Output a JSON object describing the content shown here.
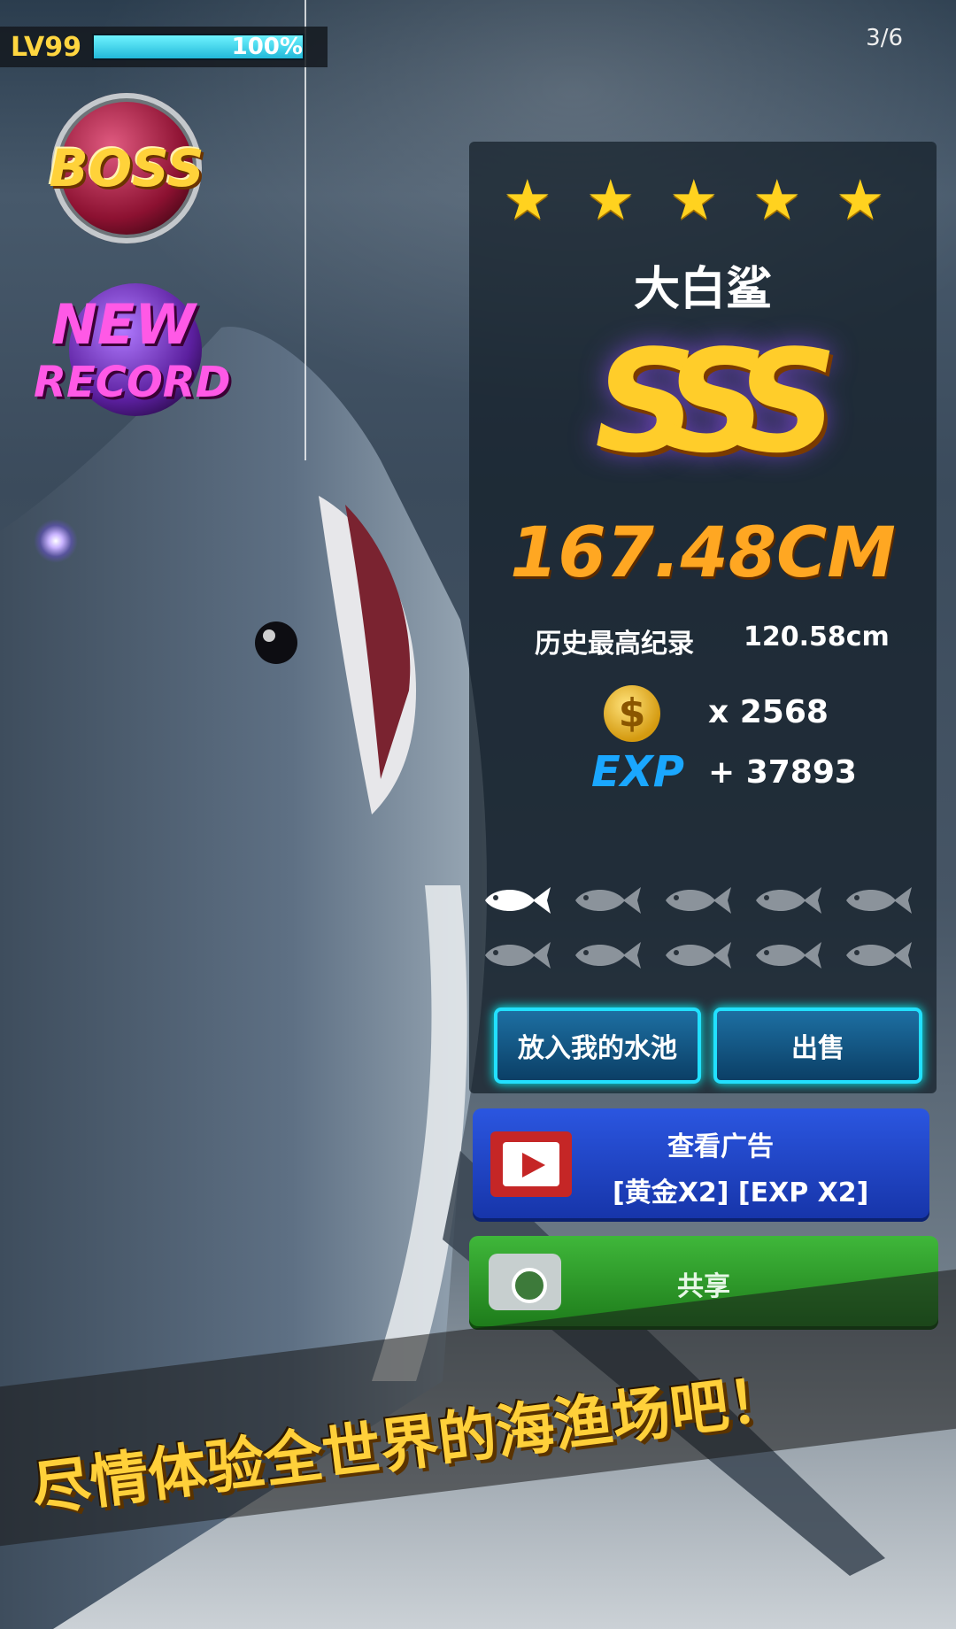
{
  "hud": {
    "level": "LV99",
    "xp_percent": "100%",
    "xp_fraction": 1.0
  },
  "pager": {
    "text": "3/6"
  },
  "badges": {
    "boss": "BOSS",
    "new": "NEW",
    "record": "RECORD"
  },
  "result": {
    "stars": 5,
    "fish_name": "大白鲨",
    "rank": "SSS",
    "size": "167.48CM",
    "best_label": "历史最高纪录",
    "best_value": "120.58cm",
    "coins": "x 2568",
    "exp_label": "EXP",
    "exp_value": "+ 37893",
    "fish_progress_caught": 1,
    "fish_progress_total": 10
  },
  "buttons": {
    "pool": "放入我的水池",
    "sell": "出售",
    "ad_line1": "查看广告",
    "ad_line2": "[黄金X2] [EXP X2]",
    "share": "共享"
  },
  "slogan": "尽情体验全世界的海渔场吧！",
  "colors": {
    "gold": "#ffd21f",
    "button_cyan": "#22e0ff",
    "ad_blue": "#2b56e0",
    "share_green": "#3fb73a"
  }
}
